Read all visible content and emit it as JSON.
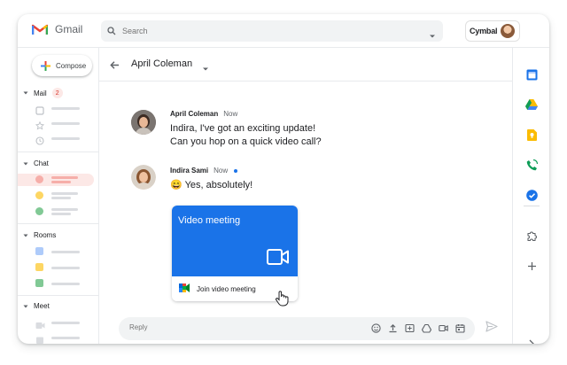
{
  "app": {
    "name": "Gmail"
  },
  "search": {
    "placeholder": "Search"
  },
  "account": {
    "brand": "Cymbal"
  },
  "compose": {
    "label": "Compose"
  },
  "sections": {
    "mail": {
      "label": "Mail",
      "badge": "2"
    },
    "chat": {
      "label": "Chat"
    },
    "rooms": {
      "label": "Rooms"
    },
    "meet": {
      "label": "Meet"
    }
  },
  "thread": {
    "title": "April Coleman"
  },
  "messages": [
    {
      "sender": "April Coleman",
      "time": "Now",
      "lines": [
        "Indira, I've got an exciting update!",
        "Can you hop on a quick video call?"
      ]
    },
    {
      "sender": "Indira Sami",
      "time": "Now",
      "emoji": "😄",
      "text": "Yes, absolutely!"
    }
  ],
  "card": {
    "title": "Video meeting",
    "action": "Join video meeting"
  },
  "reply": {
    "placeholder": "Reply"
  },
  "colors": {
    "accent": "#1a73e8",
    "badge_bg": "#fce8e6",
    "badge_fg": "#d93025",
    "active_chat": "#fce8e6"
  },
  "icons": {
    "rail": [
      "calendar-icon",
      "drive-icon",
      "keep-icon",
      "voice-icon",
      "tasks-icon",
      "addons-icon",
      "add-icon",
      "expand-icon"
    ],
    "reply": [
      "emoji-icon",
      "upload-icon",
      "gif-icon",
      "drive-icon",
      "video-icon",
      "calendar-icon"
    ]
  }
}
